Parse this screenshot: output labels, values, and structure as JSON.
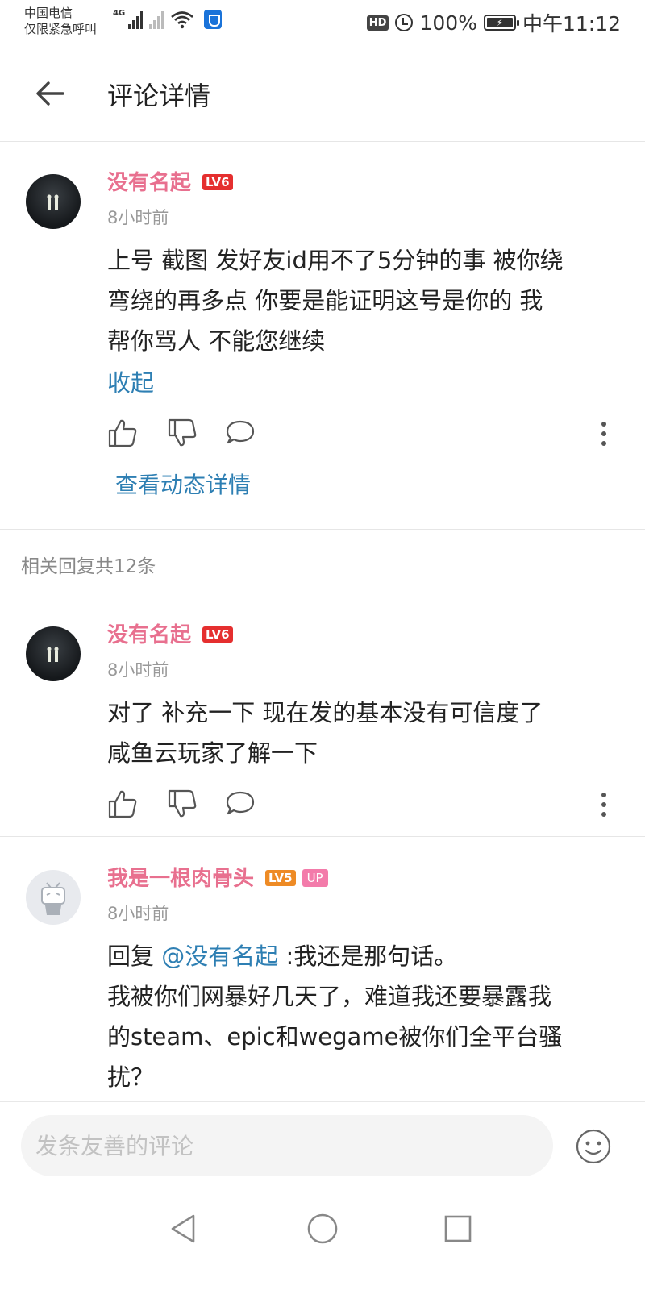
{
  "status_bar": {
    "carrier_line1": "中国电信",
    "carrier_line2": "仅限紧急呼叫",
    "network": "4G",
    "hd": "HD",
    "battery": "100%",
    "time": "中午11:12"
  },
  "header": {
    "title": "评论详情"
  },
  "main_comment": {
    "username": "没有名起",
    "level": "LV6",
    "time": "8小时前",
    "text_lines": [
      "上号 截图 发好友id用不了5分钟的事 被你绕",
      "弯绕的再多点 你要是能证明这号是你的 我",
      "帮你骂人 不能您继续"
    ],
    "fold_label": "收起",
    "view_dynamic": "查看动态详情"
  },
  "related_count": "相关回复共12条",
  "replies": [
    {
      "username": "没有名起",
      "level": "LV6",
      "time": "8小时前",
      "text_lines": [
        "对了 补充一下 现在发的基本没有可信度了",
        "咸鱼云玩家了解一下"
      ]
    },
    {
      "username": "我是一根肉骨头",
      "level": "LV5",
      "badge": "UP",
      "time": "8小时前",
      "reply_prefix": "回复 ",
      "mention": "@没有名起",
      "reply_rest": " :我还是那句话。",
      "text_lines": [
        "我被你们网暴好几天了，难道我还要暴露我",
        "的steam、epic和wegame被你们全平台骚",
        "扰？"
      ]
    }
  ],
  "input": {
    "placeholder": "发条友善的评论"
  },
  "icons": {
    "back": "arrow-left-icon",
    "like": "thumbs-up-icon",
    "dislike": "thumbs-down-icon",
    "reply": "speech-bubble-icon",
    "more": "more-vertical-icon",
    "emoji": "emoji-icon",
    "nav_back": "triangle-back-icon",
    "nav_home": "circle-home-icon",
    "nav_recent": "square-recent-icon"
  },
  "colors": {
    "username": "#e8708f",
    "link": "#2e7fb3",
    "lv6": "#e52f2f",
    "lv5": "#ee8b25",
    "up_badge": "#f37baa"
  }
}
